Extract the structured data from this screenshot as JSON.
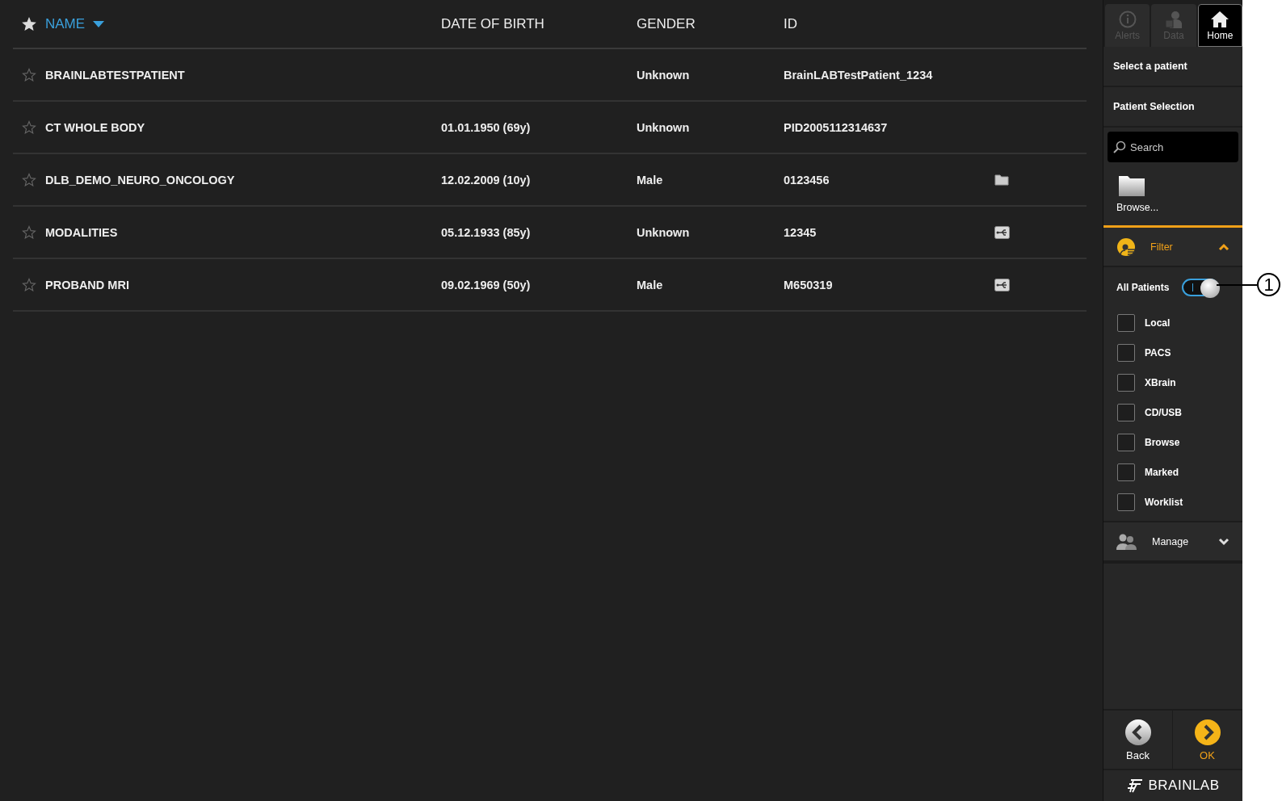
{
  "table": {
    "columns": [
      {
        "label": "NAME",
        "sorted": true
      },
      {
        "label": "DATE OF BIRTH",
        "sorted": false
      },
      {
        "label": "GENDER",
        "sorted": false
      },
      {
        "label": "ID",
        "sorted": false
      }
    ],
    "rows": [
      {
        "starred": false,
        "name": "BRAINLABTESTPATIENT",
        "date_of_birth": "",
        "gender": "Unknown",
        "id": "BrainLABTestPatient_1234",
        "kind": "plain"
      },
      {
        "starred": false,
        "name": "CT WHOLE BODY",
        "date_of_birth": "01.01.1950 (69y)",
        "gender": "Unknown",
        "id": "PID2005112314637",
        "kind": "plain"
      },
      {
        "starred": false,
        "name": "DLB_DEMO_NEURO_ONCOLOGY",
        "date_of_birth": "12.02.2009 (10y)",
        "gender": "Male",
        "id": "0123456",
        "kind": "folder"
      },
      {
        "starred": false,
        "name": "MODALITIES",
        "date_of_birth": "05.12.1933 (85y)",
        "gender": "Unknown",
        "id": "12345",
        "kind": "usb"
      },
      {
        "starred": false,
        "name": "PROBAND MRI",
        "date_of_birth": "09.02.1969 (50y)",
        "gender": "Male",
        "id": "M650319",
        "kind": "usb"
      }
    ]
  },
  "sidebar": {
    "tabs": [
      {
        "label": "Alerts",
        "kind": "info",
        "selected": false,
        "disabled": true
      },
      {
        "label": "Data",
        "kind": "data",
        "selected": false,
        "disabled": true
      },
      {
        "label": "Home",
        "kind": "home",
        "selected": true,
        "disabled": false
      }
    ],
    "heading": "Select a patient",
    "subheading": "Patient Selection",
    "search": {
      "placeholder": "Search"
    },
    "browse": "Browse...",
    "filter": {
      "label": "Filter",
      "expanded": true,
      "all_patients": {
        "label": "All Patients",
        "on": true
      },
      "options": [
        {
          "label": "Local",
          "checked": false
        },
        {
          "label": "PACS",
          "checked": false
        },
        {
          "label": "XBrain",
          "checked": false
        },
        {
          "label": "CD/USB",
          "checked": false
        },
        {
          "label": "Browse",
          "checked": false
        },
        {
          "label": "Marked",
          "checked": false
        },
        {
          "label": "Worklist",
          "checked": false
        }
      ]
    },
    "manage": {
      "label": "Manage",
      "expanded": false
    },
    "buttons": [
      {
        "label": "Back",
        "kind": "back"
      },
      {
        "label": "OK",
        "kind": "ok"
      }
    ],
    "logo": "BRAINLAB"
  },
  "callout": {
    "label": "1"
  }
}
